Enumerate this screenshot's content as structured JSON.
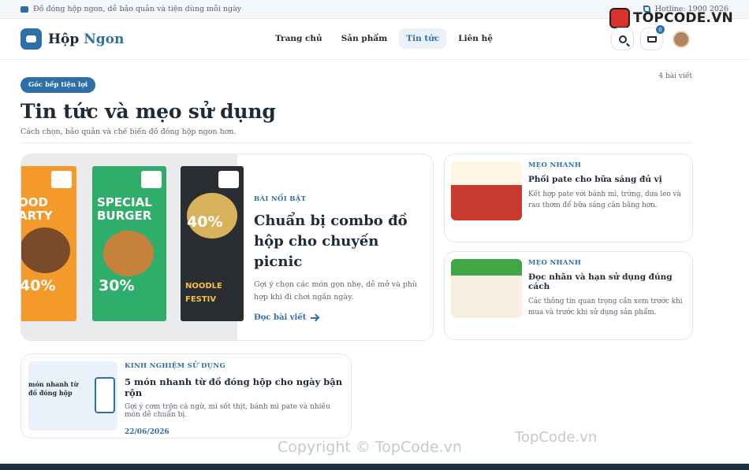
{
  "topbar": {
    "tagline": "Đồ đóng hộp ngon, dễ bảo quản và tiện dùng mỗi ngày",
    "hotline": "Hotline: 1900 2026"
  },
  "watermark": {
    "logo_text": "TOPCODE.VN",
    "bottom_text": "TopCode.vn",
    "copyright": "Copyright © TopCode.vn"
  },
  "header": {
    "brand_first": "Hộp",
    "brand_second": "Ngon",
    "nav": [
      {
        "label": "Trang chủ"
      },
      {
        "label": "Sản phẩm"
      },
      {
        "label": "Tin tức",
        "active": true
      },
      {
        "label": "Liên hệ"
      }
    ],
    "cart_count": "0",
    "accent": "#2f6fa8"
  },
  "page": {
    "badge": "Góc bếp tiện lợi",
    "title": "Tin tức và mẹo sử dụng",
    "subtitle": "Cách chọn, bảo quản và chế biến đồ đóng hộp ngon hơn.",
    "count": "4 bài viết"
  },
  "featured": {
    "kicker": "BÀI NỔI BẬT",
    "title": "Chuẩn bị combo đồ hộp cho chuyến picnic",
    "excerpt": "Gợi ý chọn các món gọn nhẹ, dễ mở và phù hợp khi đi chơi ngắn ngày.",
    "read_more": "Đọc bài viết",
    "posters": [
      {
        "text": "OOD ARTY",
        "percent": "40%",
        "color": "#f39a2b"
      },
      {
        "text": "SPECIAL BURGER",
        "percent": "30%",
        "color": "#2fae6b"
      },
      {
        "text": "NOODLE FESTIV",
        "percent": "40%",
        "color": "#2a2d31"
      }
    ]
  },
  "side_posts": [
    {
      "kicker": "MẸO NHANH",
      "title": "Phối pate cho bữa sáng đủ vị",
      "excerpt": "Kết hợp pate với bánh mì, trứng, dưa leo và rau thơm để bữa sáng cân bằng hơn."
    },
    {
      "kicker": "MẸO NHANH",
      "title": "Đọc nhãn và hạn sử dụng đúng cách",
      "excerpt": "Các thông tin quan trọng cần xem trước khi mua và trước khi sử dụng sản phẩm."
    }
  ],
  "wide_post": {
    "kicker": "KINH NGHIỆM SỬ DỤNG",
    "title": "5 món nhanh từ đồ đóng hộp cho ngày bận rộn",
    "excerpt": "Gợi ý cơm trộn cá ngừ, mì sốt thịt, bánh mì pate và nhiều món dễ chuẩn bị.",
    "date": "22/06/2026",
    "thumb_text": "món nhanh từ đồ đóng hộp"
  }
}
